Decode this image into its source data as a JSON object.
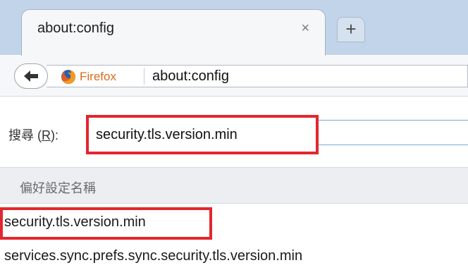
{
  "tab": {
    "title": "about:config",
    "close_glyph": "×",
    "newtab_glyph": "+"
  },
  "nav": {
    "identity_name": "Firefox",
    "url": "about:config"
  },
  "search": {
    "label_prefix": "搜尋 (",
    "label_key": "R",
    "label_suffix": "):",
    "value": "security.tls.version.min"
  },
  "table": {
    "column_header": "偏好設定名稱",
    "rows": [
      {
        "name": "security.tls.version.min"
      },
      {
        "name": "services.sync.prefs.sync.security.tls.version.min"
      }
    ]
  },
  "colors": {
    "highlight": "#e3262e",
    "firefox_orange": "#d86c1c",
    "tabstrip_bg": "#c2d4ea"
  },
  "icons": {
    "back": "back-arrow-icon",
    "identity": "firefox-logo-icon",
    "close": "close-icon",
    "newtab": "plus-icon"
  }
}
